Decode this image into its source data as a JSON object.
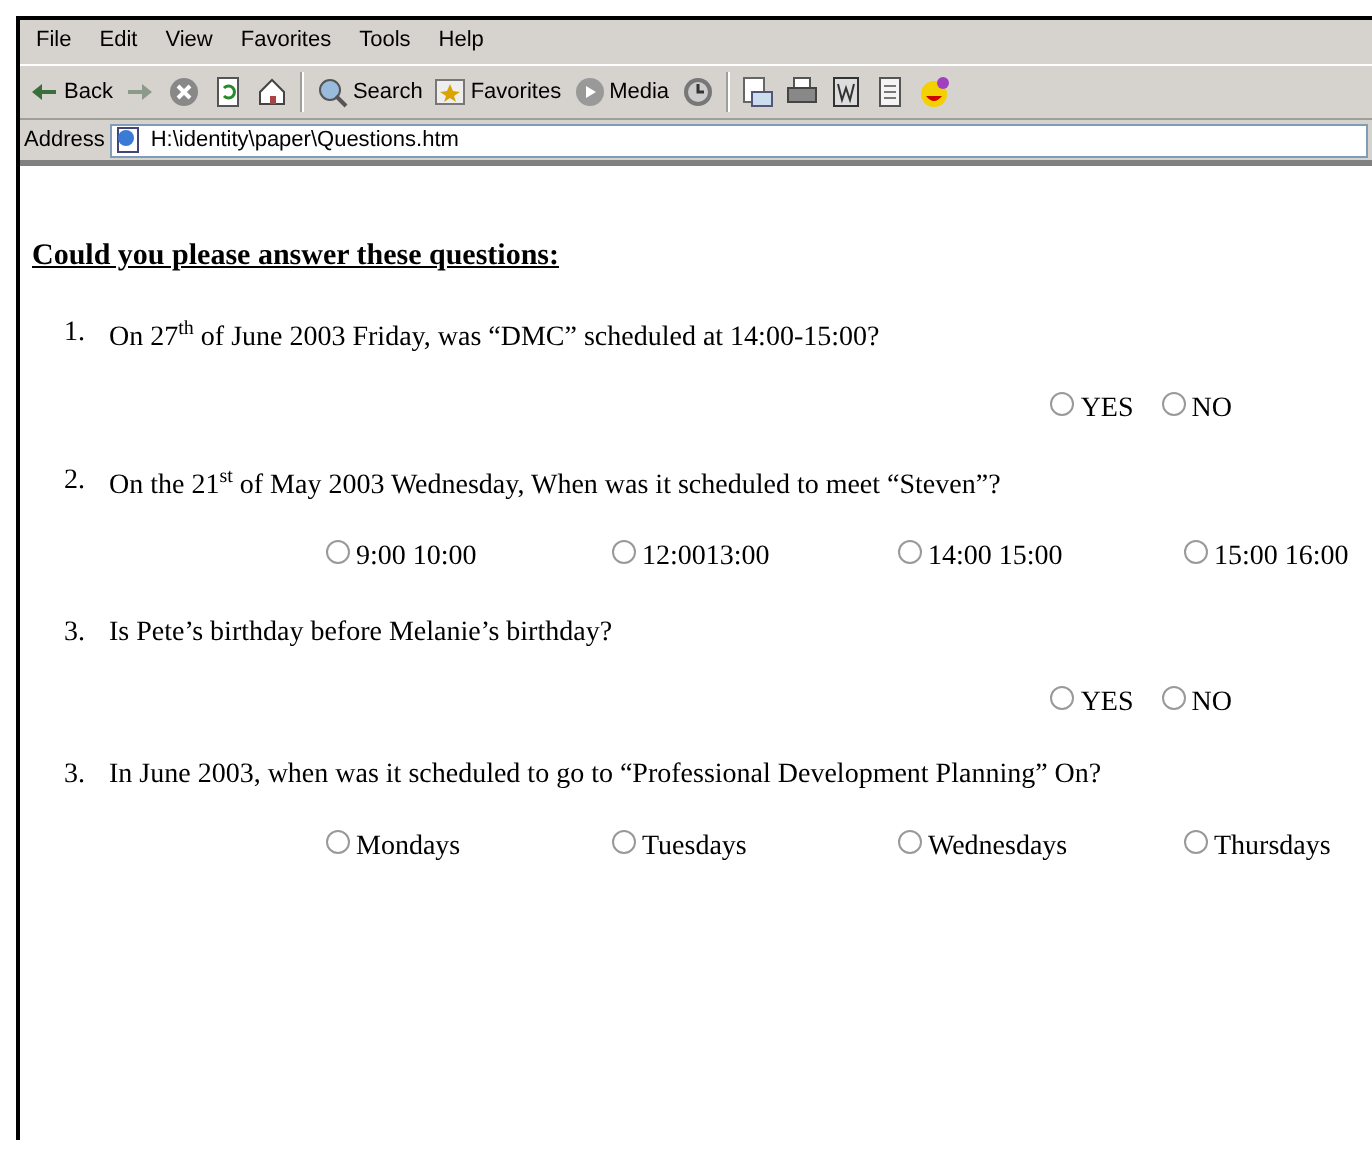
{
  "menu": [
    "File",
    "Edit",
    "View",
    "Favorites",
    "Tools",
    "Help"
  ],
  "toolbar": [
    {
      "kind": "back",
      "label": "Back"
    },
    {
      "kind": "forward"
    },
    {
      "kind": "stop"
    },
    {
      "kind": "refresh"
    },
    {
      "kind": "home"
    },
    {
      "kind": "sep"
    },
    {
      "kind": "search",
      "label": "Search"
    },
    {
      "kind": "favorites",
      "label": "Favorites"
    },
    {
      "kind": "media",
      "label": "Media"
    },
    {
      "kind": "history"
    },
    {
      "kind": "sep"
    },
    {
      "kind": "mail"
    },
    {
      "kind": "print"
    },
    {
      "kind": "edit"
    },
    {
      "kind": "discuss"
    },
    {
      "kind": "messenger"
    }
  ],
  "address": {
    "label": "Address",
    "value": "H:\\identity\\paper\\Questions.htm"
  },
  "heading": "Could you please answer these questions:",
  "questions": [
    {
      "number": "1.",
      "text": "On 27$^{th}$ of June 2003 Friday, was “DMC” scheduled at 14:00-15:00?",
      "kind": "pair",
      "options": [
        {
          "label": "YES",
          "selected": false
        },
        {
          "label": "NO",
          "selected": false
        }
      ]
    },
    {
      "number": "2.",
      "text": "On the 21$^{st}$ of May 2003 Wednesday, When was it scheduled to meet “Steven”?",
      "kind": "spread",
      "options": [
        {
          "label": "9:00 10:00",
          "selected": false
        },
        {
          "label": "12:0013:00",
          "selected": false
        },
        {
          "label": "14:00 15:00",
          "selected": false
        },
        {
          "label": "15:00 16:00",
          "selected": false
        }
      ]
    },
    {
      "number": "3.",
      "text": "Is Pete’s birthday before Melanie’s birthday?",
      "kind": "pair",
      "options": [
        {
          "label": "YES",
          "selected": false
        },
        {
          "label": "NO",
          "selected": false
        }
      ]
    },
    {
      "number": "3.",
      "text": "In June 2003, when was it scheduled to go to “Professional Development Planning” On?",
      "kind": "spread",
      "options": [
        {
          "label": "Mondays",
          "selected": false
        },
        {
          "label": "Tuesdays",
          "selected": false
        },
        {
          "label": "Wednesdays",
          "selected": false
        },
        {
          "label": "Thursdays",
          "selected": false
        }
      ]
    }
  ]
}
